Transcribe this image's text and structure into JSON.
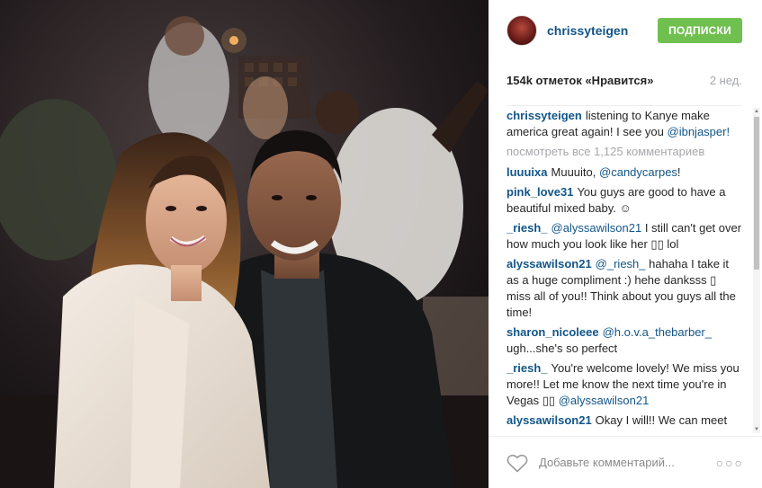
{
  "header": {
    "username": "chrissyteigen",
    "follow_label": "ПОДПИСКИ"
  },
  "stats": {
    "likes": "154k отметок «Нравится»",
    "time_ago": "2 нед."
  },
  "caption": {
    "user": "chrissyteigen",
    "text": "listening to Kanye make america great again! I see you",
    "mention": "@ibnjasper!"
  },
  "view_all": "посмотреть все 1,125 комментариев",
  "comments": [
    {
      "user": "luuuixa",
      "text": "Muuuito,",
      "mention": "@candycarpes",
      "after": "!"
    },
    {
      "user": "pink_love31",
      "text": "You guys are good to have a beautiful mixed baby. ☺",
      "mention": "",
      "after": ""
    },
    {
      "user": "_riesh_",
      "text": "",
      "mention": "@alyssawilson21",
      "after": "I still can't get over how much you look like her ▯▯ lol"
    },
    {
      "user": "alyssawilson21",
      "text": "",
      "mention": "@_riesh_",
      "after": "hahaha I take it as a huge compliment :) hehe danksss ▯ miss all of you!! Think about you guys all the time!"
    },
    {
      "user": "sharon_nicoleee",
      "text": "",
      "mention": "@h.o.v.a_thebarber_",
      "after": "ugh...she's so perfect"
    },
    {
      "user": "_riesh_",
      "text": "You're welcome lovely! We miss you more!! Let me know the next time you're in Vegas ▯▯",
      "mention": "@alyssawilson21",
      "after": ""
    },
    {
      "user": "alyssawilson21",
      "text": "Okay I will!! We can meet up and catch up I still talk to her about you guys",
      "mention": "",
      "after": ""
    }
  ],
  "footer": {
    "comment_placeholder": "Добавьте комментарий...",
    "heart_icon": "heart-outline-icon",
    "more_icon": "more-horizontal-icon"
  },
  "colors": {
    "username": "#125688",
    "follow_button": "#70c050",
    "muted_text": "#a5a7aa"
  }
}
